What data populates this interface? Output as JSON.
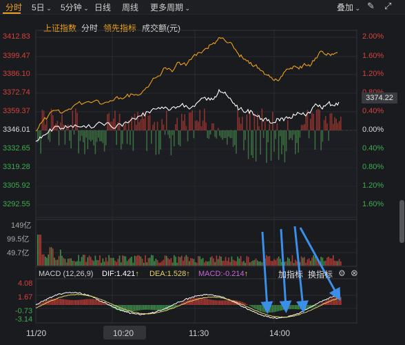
{
  "tabs": {
    "fen_shi": "分时",
    "ri5": "5日",
    "min5": "5分钟",
    "ri_xian": "日线",
    "zhou_xian": "周线",
    "more_periods": "更多周期",
    "overlay": "叠加"
  },
  "legend": {
    "index_name": "上证指数",
    "fen_shi": "分时",
    "leading": "领先指标",
    "turnover": "成交额(元)"
  },
  "price_axis": [
    "3412.83",
    "3399.47",
    "3386.10",
    "3372.74",
    "3359.37",
    "3346.01",
    "3332.65",
    "3319.28",
    "3305.92",
    "3292.55"
  ],
  "pct_axis": [
    "2.00%",
    "1.60%",
    "1.20%",
    "0.80%",
    "0.40%",
    "0.00%",
    "0.40%",
    "0.80%",
    "1.20%",
    "1.60%"
  ],
  "current_price": "3374.22",
  "volume_axis": [
    "149亿",
    "99.5亿",
    "49.7亿"
  ],
  "macd": {
    "name": "MACD (12,26,9)",
    "dif": "DIF:1.421",
    "dea": "DEA:1.528",
    "macd_val": "MACD:-0.214",
    "arrow": "↑",
    "axis": [
      "4.08",
      "1.67",
      "-0.73",
      "-3.14"
    ],
    "add_indicator": "加指标",
    "switch_indicator": "换指标"
  },
  "time_axis": [
    "11/20",
    "10:20",
    "11:30",
    "14:00"
  ],
  "colors": {
    "up": "#d4433c",
    "down": "#3dae4f",
    "accent": "#f0a21a",
    "price_line": "#ffffff",
    "leading_line": "#f0a21a",
    "dea_line": "#e7d36a",
    "annotation": "#3b8fe8"
  },
  "icons": [
    "pen-icon",
    "fullscreen-icon",
    "gear-icon",
    "close-icon",
    "chevron-down-icon"
  ]
}
